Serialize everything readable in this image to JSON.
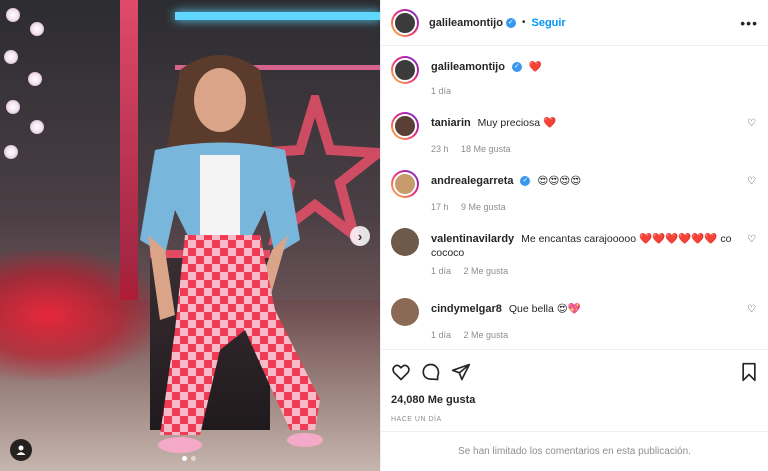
{
  "post": {
    "author": "galileamontijo",
    "follow_label": "Seguir",
    "separator": "•",
    "more_icon": "more-horizontal-icon"
  },
  "caption": {
    "username": "galileamontijo",
    "text": "❤️",
    "time": "1 día"
  },
  "comments": [
    {
      "username": "taniarin",
      "text": "Muy preciosa ❤️",
      "time": "23 h",
      "likes": "18 Me gusta",
      "verified": false
    },
    {
      "username": "andrealegarreta",
      "text": "😍😍😍😍",
      "time": "17 h",
      "likes": "9 Me gusta",
      "verified": true
    },
    {
      "username": "valentinavilardy",
      "text": "Me encantas carajooooo ❤️❤️❤️❤️❤️❤️ co cococo",
      "time": "1 día",
      "likes": "2 Me gusta",
      "verified": false
    },
    {
      "username": "cindymelgar8",
      "text": "Que bella 😍💖",
      "time": "1 día",
      "likes": "2 Me gusta",
      "verified": false
    }
  ],
  "engagement": {
    "likes": "24,080 Me gusta",
    "posted_ago": "HACE UN DÍA",
    "comments_limited": "Se han limitado los comentarios en esta publicación."
  },
  "carousel": {
    "current": 1,
    "total": 2
  },
  "colors": {
    "accent": "#0095f6",
    "verified": "#3897f0",
    "heart": "#ed4956"
  }
}
